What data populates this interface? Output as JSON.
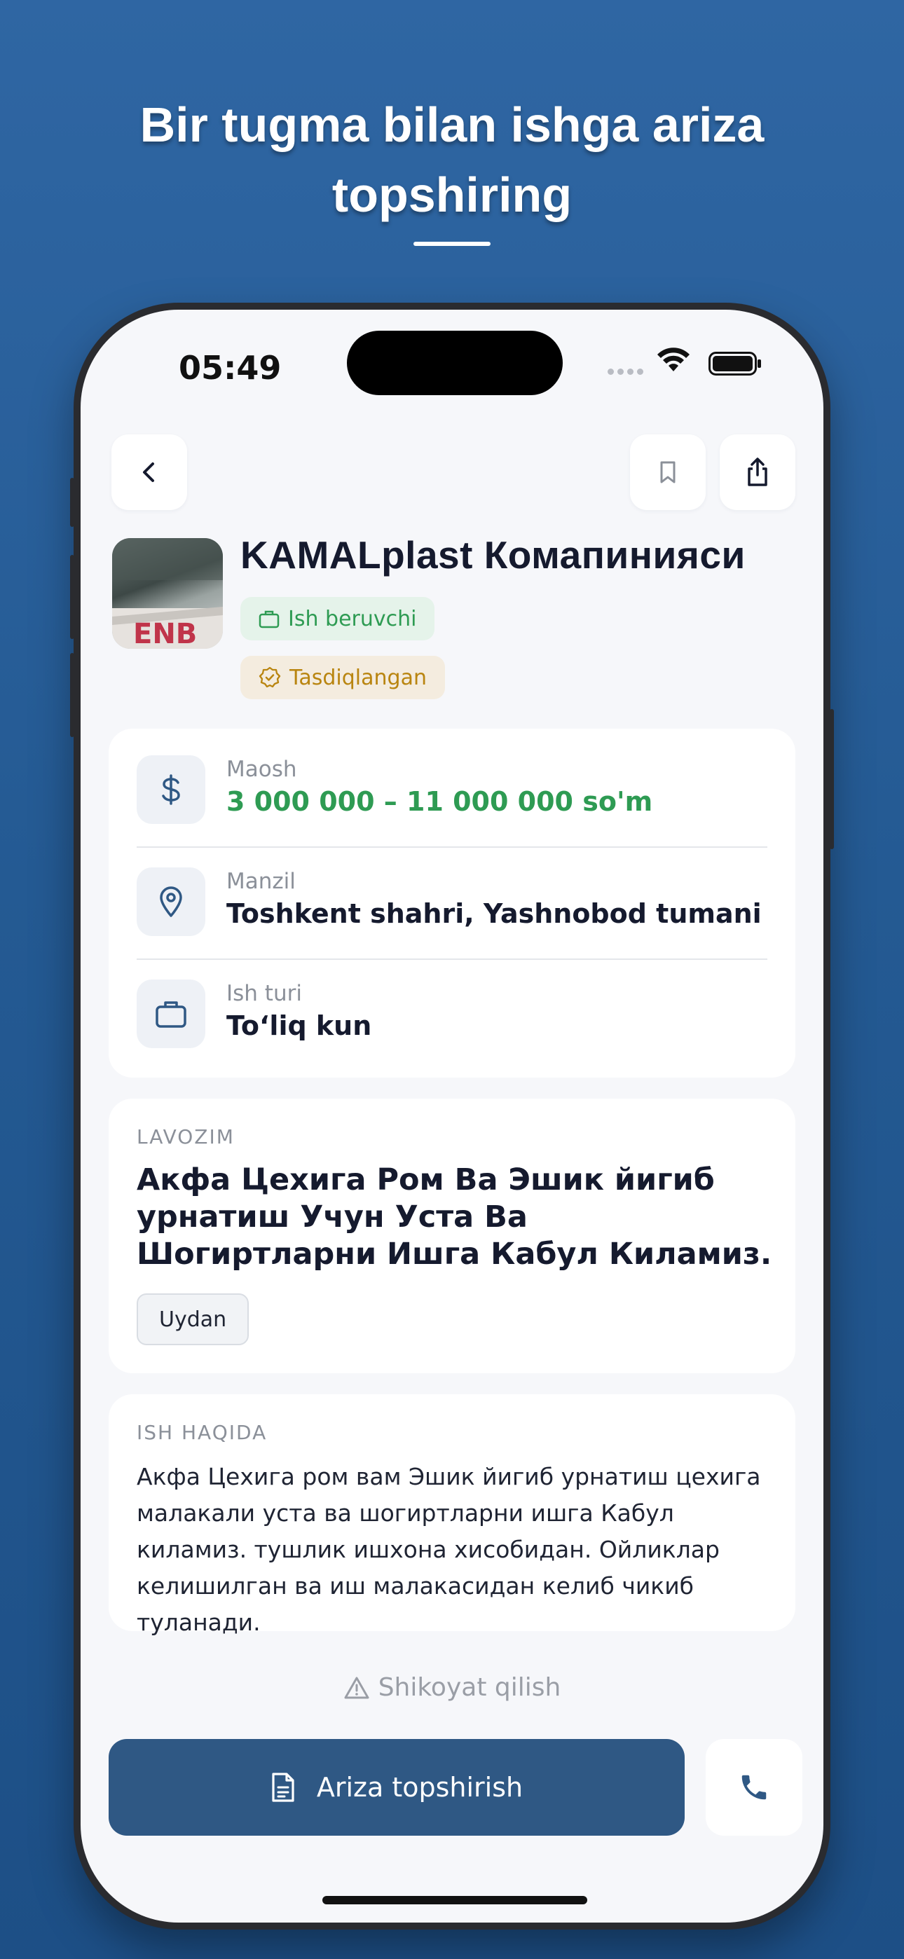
{
  "headline": {
    "line1": "Bir tugma bilan ishga ariza",
    "line2": "topshiring"
  },
  "status_bar": {
    "time": "05:49"
  },
  "header": {
    "company_name": "KAMALplast Комапинияси",
    "badge_employer": "Ish beruvchi",
    "badge_verified": "Tasdiqlangan"
  },
  "info": {
    "salary_label": "Maosh",
    "salary_value": "3 000 000 – 11 000 000 so'm",
    "address_label": "Manzil",
    "address_value": "Toshkent shahri, Yashnobod tumani",
    "jobtype_label": "Ish turi",
    "jobtype_value": "To‘liq kun"
  },
  "position": {
    "label": "LAVOZIM",
    "title": "Акфа Цехига Ром Ва Эшик йигиб урнатиш Учун Уста Ва Шогиртларни Ишга Кабул Киламиз.",
    "tag": "Uydan"
  },
  "about": {
    "label": "ISH HAQIDA",
    "text": "Акфа Цехига ром вам Эшик йигиб урнатиш цехига малакали уста ва шогиртларни ишга Кабул киламиз. тушлик ишхона хисобидан. Ойликлар келишилган ва иш малакасидан келиб чикиб туланади."
  },
  "actions": {
    "report": "Shikoyat qilish",
    "apply": "Ariza topshirish"
  },
  "colors": {
    "accent": "#2f5884",
    "salary": "#2e9b53",
    "verified": "#b98510",
    "background_top": "#2f66a3"
  }
}
